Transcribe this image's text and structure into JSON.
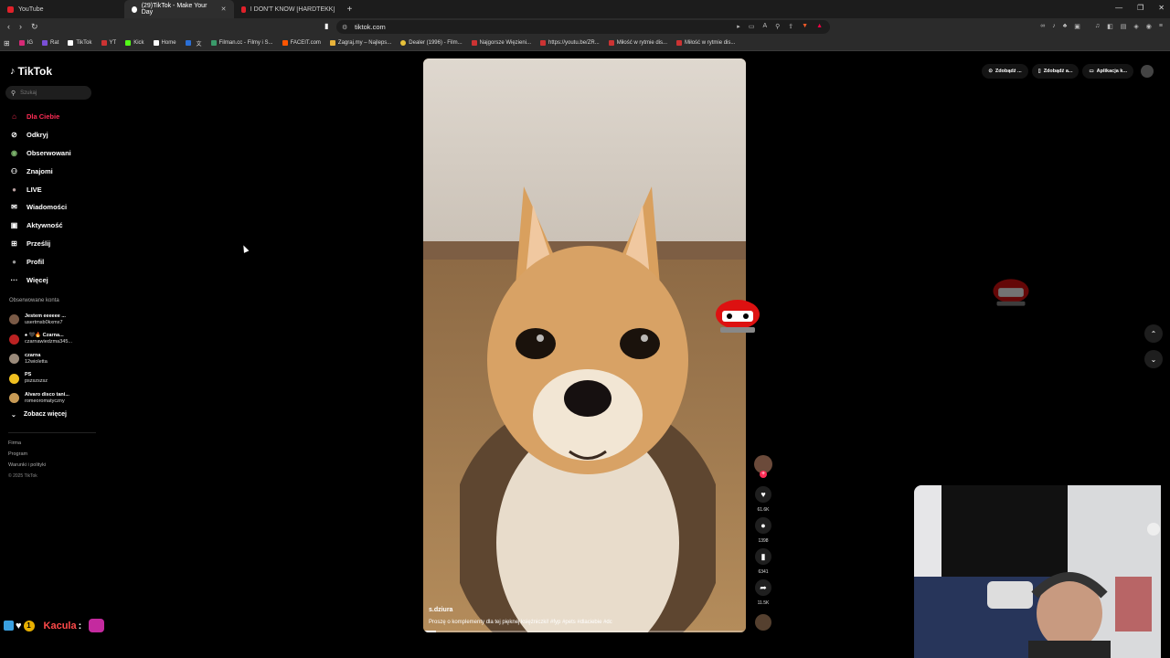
{
  "browser": {
    "tabs": [
      {
        "label": "YouTube",
        "active": false
      },
      {
        "label": "(29)TikTok - Make Your Day",
        "active": true
      },
      {
        "label": "I DON'T KNOW [HARDTEKK] - YouTu...",
        "active": false
      }
    ],
    "new_tab": "+",
    "url": "tiktok.com",
    "bookmarks": [
      "IG",
      "Rat",
      "TikTok",
      "YT",
      "Kick",
      "Home",
      "",
      "Filman.cc - Filmy i S...",
      "FACEIT.com",
      "Zagraj.my – Najleps...",
      "Dealer (1996) - Film...",
      "Najgorsze Więzieni...",
      "https://youtu.be/ZR...",
      "Miłość w rytmie dis...",
      "Miłość w rytmie dis..."
    ]
  },
  "tiktok": {
    "logo": "TikTok",
    "search_placeholder": "Szukaj",
    "menu": [
      {
        "label": "Dla Ciebie",
        "icon": "home-icon",
        "active": true
      },
      {
        "label": "Odkryj",
        "icon": "compass-icon",
        "active": false
      },
      {
        "label": "Obserwowani",
        "icon": "following-icon",
        "active": false
      },
      {
        "label": "Znajomi",
        "icon": "friends-icon",
        "active": false
      },
      {
        "label": "LIVE",
        "icon": "live-icon",
        "active": false
      },
      {
        "label": "Wiadomości",
        "icon": "message-icon",
        "active": false
      },
      {
        "label": "Aktywność",
        "icon": "activity-icon",
        "active": false
      },
      {
        "label": "Prześlij",
        "icon": "upload-icon",
        "active": false
      },
      {
        "label": "Profil",
        "icon": "profile-icon",
        "active": false
      },
      {
        "label": "Więcej",
        "icon": "more-icon",
        "active": false
      }
    ],
    "followed_title": "Obserwowane konta",
    "followed": [
      {
        "name": "Jestem eeeeee ...",
        "handle": "usertmsb0kxmx7"
      },
      {
        "name": "♠ 🖤🔥 Czarna...",
        "handle": "czarnawiedzma345..."
      },
      {
        "name": "czarna",
        "handle": "12wioletta"
      },
      {
        "name": "PS",
        "handle": "pszszszsz"
      },
      {
        "name": "Alvaro disco tani...",
        "handle": "romeoromatyczny"
      }
    ],
    "see_more": "Zobacz więcej",
    "footer": [
      "Firma",
      "Program",
      "Warunki i polityki"
    ],
    "copyright": "© 2025 TikTok",
    "top_right": [
      "Zdobądź ...",
      "Zdobądź a...",
      "Aplikacja k..."
    ]
  },
  "video": {
    "username": "s.dziura",
    "description": "Proszę o komplementy dla tej pięknej księżniczki! #fyp #pets #dlaciebie #dc",
    "progress": 0.04,
    "likes": "61.6K",
    "comments": "1398",
    "saves": "6341",
    "shares": "11.5K"
  },
  "stream_chat": {
    "username": "Kacula",
    "separator": ":"
  },
  "colors": {
    "accent": "#fe2c55",
    "background": "#000000"
  }
}
